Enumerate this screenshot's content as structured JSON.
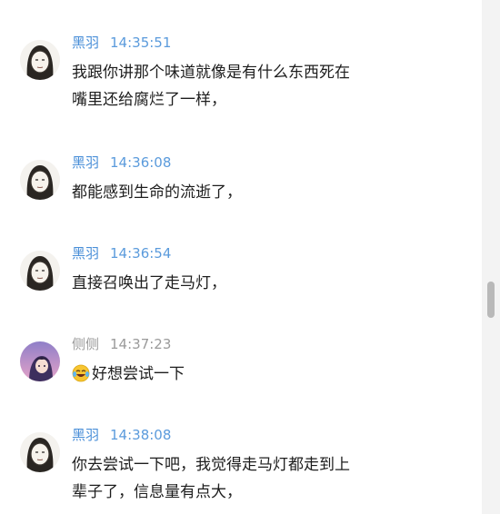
{
  "messages": [
    {
      "sender": "黑羽",
      "time": "14:35:51",
      "avatar": "sketch-face-icon",
      "lines": [
        "我跟你讲那个味道就像是有什么东西死在",
        "嘴里还给腐烂了一样，"
      ]
    },
    {
      "sender": "黑羽",
      "time": "14:36:08",
      "avatar": "sketch-face-icon",
      "lines": [
        "都能感到生命的流逝了，"
      ]
    },
    {
      "sender": "黑羽",
      "time": "14:36:54",
      "avatar": "sketch-face-icon",
      "lines": [
        "直接召唤出了走马灯，"
      ]
    },
    {
      "sender": "侧侧",
      "time": "14:37:23",
      "avatar": "anime-girl-icon",
      "emoji": "laughing-tears-emoji",
      "lines": [
        "好想尝试一下"
      ]
    },
    {
      "sender": "黑羽",
      "time": "14:38:08",
      "avatar": "sketch-face-icon",
      "lines": [
        "你去尝试一下吧，我觉得走马灯都走到上",
        "辈子了，信息量有点大，"
      ]
    }
  ],
  "colors": {
    "name_blue": "#4a8fd8",
    "meta_gray": "#9a9a9a",
    "text": "#1d1d1d"
  }
}
